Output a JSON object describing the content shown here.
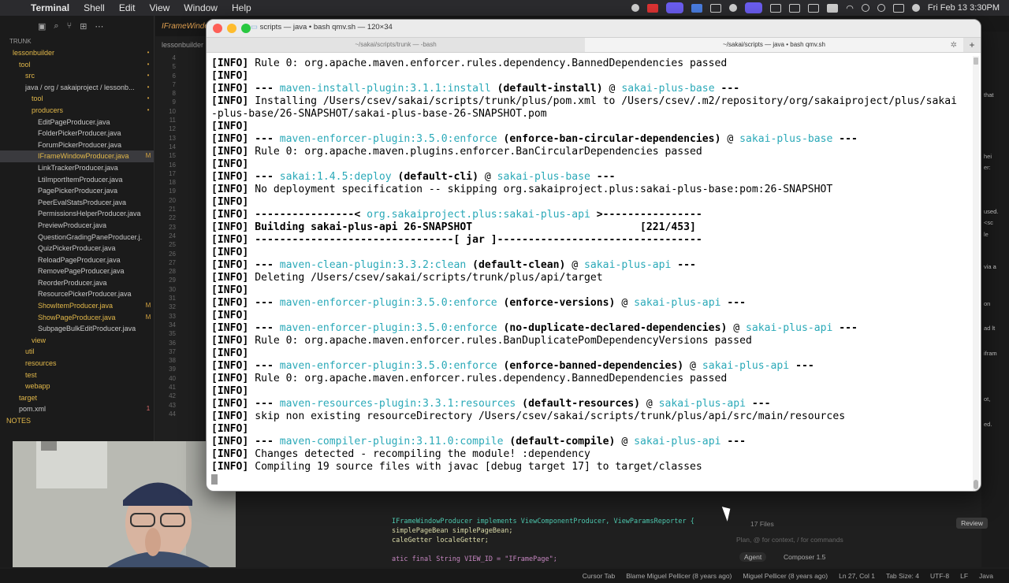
{
  "menubar": {
    "apple": "",
    "app": "Terminal",
    "items": [
      "Shell",
      "Edit",
      "View",
      "Window",
      "Help"
    ],
    "datetime": "Fri Feb 13  3:30PM"
  },
  "ide": {
    "tab": "IFrameWindowProducer.java",
    "subtab": "lessonbuilder",
    "sidebar_header": "TRUNK",
    "tree": [
      {
        "label": "lessonbuilder",
        "badge": "•",
        "indent": 1
      },
      {
        "label": "tool",
        "badge": "•",
        "indent": 2
      },
      {
        "label": "src",
        "badge": "•",
        "indent": 3
      },
      {
        "label": "java / org / sakaiproject / lessonb...",
        "badge": "•",
        "indent": 3
      },
      {
        "label": "tool",
        "badge": "•",
        "indent": 4
      },
      {
        "label": "producers",
        "badge": "•",
        "indent": 4
      },
      {
        "label": "EditPageProducer.java",
        "badge": "",
        "indent": 5
      },
      {
        "label": "FolderPickerProducer.java",
        "badge": "",
        "indent": 5
      },
      {
        "label": "ForumPickerProducer.java",
        "badge": "",
        "indent": 5
      },
      {
        "label": "IFrameWindowProducer.java",
        "badge": "M",
        "indent": 5
      },
      {
        "label": "LinkTrackerProducer.java",
        "badge": "",
        "indent": 5
      },
      {
        "label": "LtiImportItemProducer.java",
        "badge": "",
        "indent": 5
      },
      {
        "label": "PagePickerProducer.java",
        "badge": "",
        "indent": 5
      },
      {
        "label": "PeerEvalStatsProducer.java",
        "badge": "",
        "indent": 5
      },
      {
        "label": "PermissionsHelperProducer.java",
        "badge": "",
        "indent": 5
      },
      {
        "label": "PreviewProducer.java",
        "badge": "",
        "indent": 5
      },
      {
        "label": "QuestionGradingPaneProducer.j...",
        "badge": "",
        "indent": 5
      },
      {
        "label": "QuizPickerProducer.java",
        "badge": "",
        "indent": 5
      },
      {
        "label": "ReloadPageProducer.java",
        "badge": "",
        "indent": 5
      },
      {
        "label": "RemovePageProducer.java",
        "badge": "",
        "indent": 5
      },
      {
        "label": "ReorderProducer.java",
        "badge": "",
        "indent": 5
      },
      {
        "label": "ResourcePickerProducer.java",
        "badge": "",
        "indent": 5
      },
      {
        "label": "ShowItemProducer.java",
        "badge": "M",
        "indent": 5
      },
      {
        "label": "ShowPageProducer.java",
        "badge": "M",
        "indent": 5
      },
      {
        "label": "SubpageBulkEditProducer.java",
        "badge": "",
        "indent": 5
      },
      {
        "label": "view",
        "badge": "",
        "indent": 4
      },
      {
        "label": "util",
        "badge": "",
        "indent": 3
      },
      {
        "label": "resources",
        "badge": "",
        "indent": 3
      },
      {
        "label": "test",
        "badge": "",
        "indent": 3
      },
      {
        "label": "webapp",
        "badge": "",
        "indent": 3
      },
      {
        "label": "target",
        "badge": "",
        "indent": 2
      },
      {
        "label": "pom.xml",
        "badge": "1",
        "indent": 2
      },
      {
        "label": "NOTES",
        "badge": "",
        "indent": 0
      }
    ],
    "line_numbers": [
      "4",
      "5",
      "6",
      "7",
      "8",
      "9",
      "10",
      "11",
      "12",
      "13",
      "14",
      "15",
      "16",
      "17",
      "18",
      "19",
      "20",
      "21",
      "22",
      "23",
      "24",
      "25",
      "26",
      "27",
      "28",
      "29",
      "30",
      "31",
      "32",
      "33",
      "34",
      "35",
      "36",
      "37",
      "38",
      "39",
      "40",
      "41",
      "42",
      "43",
      "44"
    ],
    "bottom_code": [
      "IFrameWindowProducer implements ViewComponentProducer, ViewParamsReporter {",
      "simplePageBean simplePageBean;",
      "caleGetter localeGetter;",
      "",
      "atic final String VIEW_ID = \"IFramePage\";"
    ],
    "agent": {
      "files": "17 Files",
      "review": "Review",
      "placeholder": "Plan, @ for context, / for commands",
      "mode": "Agent",
      "model": "Composer 1.5"
    },
    "status": [
      "Cursor Tab",
      "Blame Miguel Pellicer (8 years ago)",
      "Miguel Pellicer (8 years ago)",
      "Ln 27, Col 1",
      "Tab Size: 4",
      "UTF-8",
      "LF",
      "Java"
    ],
    "rightpane": [
      "that",
      "hei",
      "er:",
      "used.",
      "<sc",
      "le",
      "via a",
      "on",
      "ad lt",
      "ifram",
      "ot,",
      "ed."
    ]
  },
  "terminal": {
    "title": "scripts — java • bash qmv.sh — 120×34",
    "tabs": [
      "~/sakai/scripts/trunk — -bash",
      "~/sakai/scripts — java • bash qmv.sh"
    ],
    "lines": [
      [
        {
          "t": "[INFO] ",
          "s": "b"
        },
        {
          "t": "Rule 0: org.apache.maven.enforcer.rules.dependency.BannedDependencies passed"
        }
      ],
      [
        {
          "t": "[INFO]",
          "s": "b"
        }
      ],
      [
        {
          "t": "[INFO] ",
          "s": "b"
        },
        {
          "t": "--- ",
          "s": "b"
        },
        {
          "t": "maven-install-plugin:3.1.1:install",
          "s": "c"
        },
        {
          "t": " (default-install)",
          "s": "b"
        },
        {
          "t": " @ "
        },
        {
          "t": "sakai-plus-base",
          "s": "c"
        },
        {
          "t": " ---",
          "s": "b"
        }
      ],
      [
        {
          "t": "[INFO] ",
          "s": "b"
        },
        {
          "t": "Installing /Users/csev/sakai/scripts/trunk/plus/pom.xml to /Users/csev/.m2/repository/org/sakaiproject/plus/sakai"
        }
      ],
      [
        {
          "t": "-plus-base/26-SNAPSHOT/sakai-plus-base-26-SNAPSHOT.pom"
        }
      ],
      [
        {
          "t": "[INFO]",
          "s": "b"
        }
      ],
      [
        {
          "t": "[INFO] ",
          "s": "b"
        },
        {
          "t": "--- ",
          "s": "b"
        },
        {
          "t": "maven-enforcer-plugin:3.5.0:enforce",
          "s": "c"
        },
        {
          "t": " (enforce-ban-circular-dependencies)",
          "s": "b"
        },
        {
          "t": " @ "
        },
        {
          "t": "sakai-plus-base",
          "s": "c"
        },
        {
          "t": " ---",
          "s": "b"
        }
      ],
      [
        {
          "t": "[INFO] ",
          "s": "b"
        },
        {
          "t": "Rule 0: org.apache.maven.plugins.enforcer.BanCircularDependencies passed"
        }
      ],
      [
        {
          "t": "[INFO]",
          "s": "b"
        }
      ],
      [
        {
          "t": "[INFO] ",
          "s": "b"
        },
        {
          "t": "--- ",
          "s": "b"
        },
        {
          "t": "sakai:1.4.5:deploy",
          "s": "c"
        },
        {
          "t": " (default-cli)",
          "s": "b"
        },
        {
          "t": " @ "
        },
        {
          "t": "sakai-plus-base",
          "s": "c"
        },
        {
          "t": " ---",
          "s": "b"
        }
      ],
      [
        {
          "t": "[INFO] ",
          "s": "b"
        },
        {
          "t": "No deployment specification -- skipping org.sakaiproject.plus:sakai-plus-base:pom:26-SNAPSHOT"
        }
      ],
      [
        {
          "t": "[INFO]",
          "s": "b"
        }
      ],
      [
        {
          "t": "[INFO] ",
          "s": "b"
        },
        {
          "t": "----------------< ",
          "s": "b"
        },
        {
          "t": "org.sakaiproject.plus:sakai-plus-api",
          "s": "c"
        },
        {
          "t": " >----------------",
          "s": "b"
        }
      ],
      [
        {
          "t": "[INFO] ",
          "s": "b"
        },
        {
          "t": "Building sakai-plus-api 26-SNAPSHOT                           [221/453]",
          "s": "b"
        }
      ],
      [
        {
          "t": "[INFO] ",
          "s": "b"
        },
        {
          "t": "--------------------------------[ jar ]---------------------------------",
          "s": "b"
        }
      ],
      [
        {
          "t": "[INFO]",
          "s": "b"
        }
      ],
      [
        {
          "t": "[INFO] ",
          "s": "b"
        },
        {
          "t": "--- ",
          "s": "b"
        },
        {
          "t": "maven-clean-plugin:3.3.2:clean",
          "s": "c"
        },
        {
          "t": " (default-clean)",
          "s": "b"
        },
        {
          "t": " @ "
        },
        {
          "t": "sakai-plus-api",
          "s": "c"
        },
        {
          "t": " ---",
          "s": "b"
        }
      ],
      [
        {
          "t": "[INFO] ",
          "s": "b"
        },
        {
          "t": "Deleting /Users/csev/sakai/scripts/trunk/plus/api/target"
        }
      ],
      [
        {
          "t": "[INFO]",
          "s": "b"
        }
      ],
      [
        {
          "t": "[INFO] ",
          "s": "b"
        },
        {
          "t": "--- ",
          "s": "b"
        },
        {
          "t": "maven-enforcer-plugin:3.5.0:enforce",
          "s": "c"
        },
        {
          "t": " (enforce-versions)",
          "s": "b"
        },
        {
          "t": " @ "
        },
        {
          "t": "sakai-plus-api",
          "s": "c"
        },
        {
          "t": " ---",
          "s": "b"
        }
      ],
      [
        {
          "t": "[INFO]",
          "s": "b"
        }
      ],
      [
        {
          "t": "[INFO] ",
          "s": "b"
        },
        {
          "t": "--- ",
          "s": "b"
        },
        {
          "t": "maven-enforcer-plugin:3.5.0:enforce",
          "s": "c"
        },
        {
          "t": " (no-duplicate-declared-dependencies)",
          "s": "b"
        },
        {
          "t": " @ "
        },
        {
          "t": "sakai-plus-api",
          "s": "c"
        },
        {
          "t": " ---",
          "s": "b"
        }
      ],
      [
        {
          "t": "[INFO] ",
          "s": "b"
        },
        {
          "t": "Rule 0: org.apache.maven.enforcer.rules.BanDuplicatePomDependencyVersions passed"
        }
      ],
      [
        {
          "t": "[INFO]",
          "s": "b"
        }
      ],
      [
        {
          "t": "[INFO] ",
          "s": "b"
        },
        {
          "t": "--- ",
          "s": "b"
        },
        {
          "t": "maven-enforcer-plugin:3.5.0:enforce",
          "s": "c"
        },
        {
          "t": " (enforce-banned-dependencies)",
          "s": "b"
        },
        {
          "t": " @ "
        },
        {
          "t": "sakai-plus-api",
          "s": "c"
        },
        {
          "t": " ---",
          "s": "b"
        }
      ],
      [
        {
          "t": "[INFO] ",
          "s": "b"
        },
        {
          "t": "Rule 0: org.apache.maven.enforcer.rules.dependency.BannedDependencies passed"
        }
      ],
      [
        {
          "t": "[INFO]",
          "s": "b"
        }
      ],
      [
        {
          "t": "[INFO] ",
          "s": "b"
        },
        {
          "t": "--- ",
          "s": "b"
        },
        {
          "t": "maven-resources-plugin:3.3.1:resources",
          "s": "c"
        },
        {
          "t": " (default-resources)",
          "s": "b"
        },
        {
          "t": " @ "
        },
        {
          "t": "sakai-plus-api",
          "s": "c"
        },
        {
          "t": " ---",
          "s": "b"
        }
      ],
      [
        {
          "t": "[INFO] ",
          "s": "b"
        },
        {
          "t": "skip non existing resourceDirectory /Users/csev/sakai/scripts/trunk/plus/api/src/main/resources"
        }
      ],
      [
        {
          "t": "[INFO]",
          "s": "b"
        }
      ],
      [
        {
          "t": "[INFO] ",
          "s": "b"
        },
        {
          "t": "--- ",
          "s": "b"
        },
        {
          "t": "maven-compiler-plugin:3.11.0:compile",
          "s": "c"
        },
        {
          "t": " (default-compile)",
          "s": "b"
        },
        {
          "t": " @ "
        },
        {
          "t": "sakai-plus-api",
          "s": "c"
        },
        {
          "t": " ---",
          "s": "b"
        }
      ],
      [
        {
          "t": "[INFO] ",
          "s": "b"
        },
        {
          "t": "Changes detected - recompiling the module! :dependency"
        }
      ],
      [
        {
          "t": "[INFO] ",
          "s": "b"
        },
        {
          "t": "Compiling 19 source files with javac [debug target 17] to target/classes"
        }
      ]
    ]
  }
}
